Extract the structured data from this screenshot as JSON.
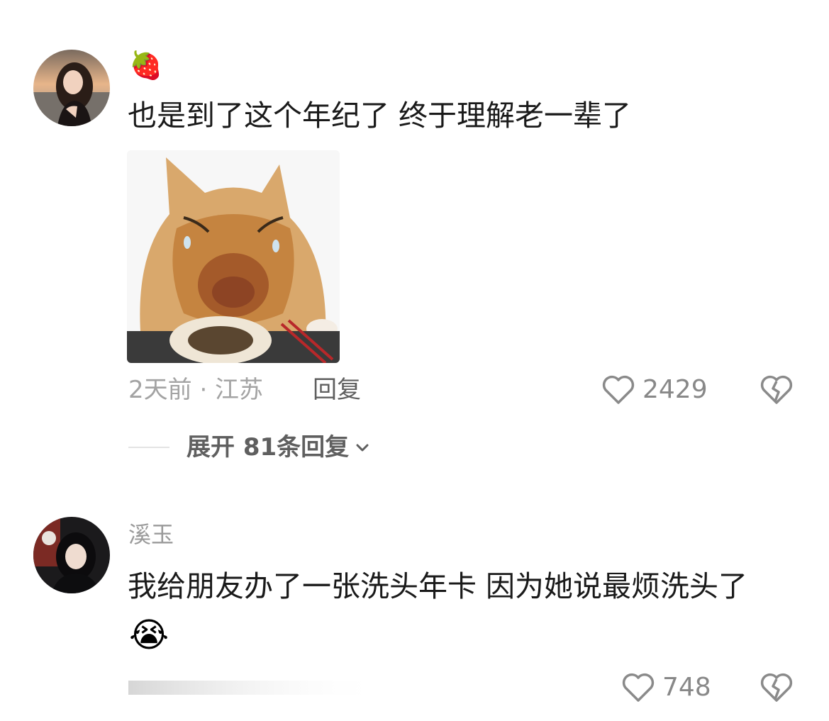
{
  "comments": [
    {
      "emoji_badge": "🍓",
      "text": "也是到了这个年纪了 终于理解老一辈了",
      "image_icon": "crying-cat-sticker",
      "meta": "2天前 · 江苏",
      "reply_label": "回复",
      "likes": "2429",
      "expand_label": "展开 81条回复"
    },
    {
      "username": "溪玉",
      "text": "我给朋友办了一张洗头年卡 因为她说最烦洗头了",
      "trailing_emoji": "😭",
      "likes": "748"
    }
  ],
  "icons": {
    "like": "heart-outline-icon",
    "dislike": "broken-heart-icon",
    "expand": "chevron-down-icon"
  },
  "colors": {
    "text": "#1a1a1a",
    "muted": "#9a9a9a",
    "action": "#5f5f5f"
  }
}
